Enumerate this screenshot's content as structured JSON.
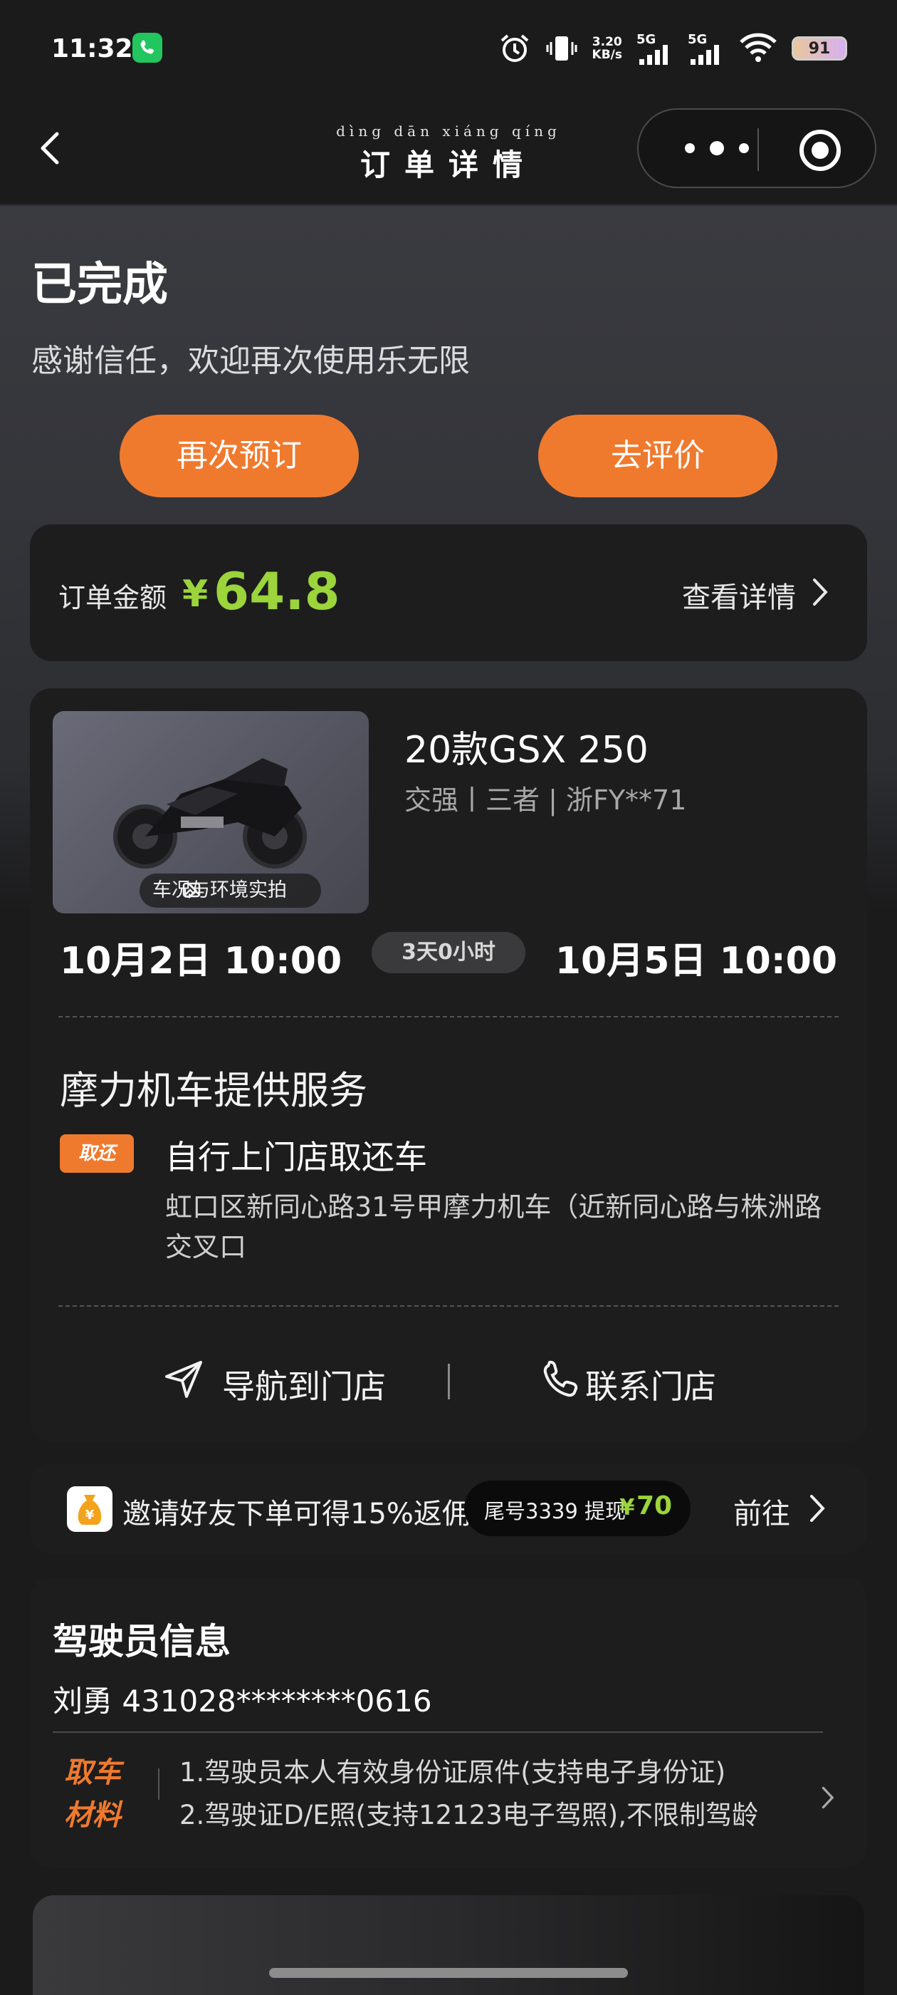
{
  "status_bar": {
    "time": "11:32",
    "net_speed_value": "3.20",
    "net_speed_unit": "KB/s",
    "signal1": "5G",
    "signal2": "5G",
    "battery": "91"
  },
  "nav": {
    "pinyin": "dìng dān xiáng qíng",
    "title": "订单详情"
  },
  "order_status": {
    "title": "已完成",
    "subtitle": "感谢信任，欢迎再次使用乐无限",
    "rebook_label": "再次预订",
    "review_label": "去评价"
  },
  "amount": {
    "label": "订单金额",
    "currency": "¥",
    "value": "64.8",
    "detail_label": "查看详情"
  },
  "vehicle": {
    "name": "20款GSX 250",
    "meta": "交强丨三者 | 浙FY**71",
    "photo_tag": "车况与环境实拍",
    "start": "10月2日 10:00",
    "duration": "3天0小时",
    "end": "10月5日 10:00",
    "provider": "摩力机车提供服务",
    "pickup_tag": "取还",
    "pickup_title": "自行上门店取还车",
    "address": "虹口区新同心路31号甲摩力机车（近新同心路与株洲路交叉口",
    "navigate_label": "导航到门店",
    "contact_label": "联系门店"
  },
  "invite": {
    "text": "邀请好友下单可得15%返佣",
    "pill_text": "尾号3339 提现",
    "pill_currency": "¥",
    "pill_value": "70",
    "go_label": "前往"
  },
  "driver": {
    "title": "驾驶员信息",
    "info": "刘勇   431028********0616",
    "material_tag_line1": "取车",
    "material_tag_line2": "材料",
    "item1": "1.驾驶员本人有效身份证原件(支持电子身份证)",
    "item2": "2.驾驶证D/E照(支持12123电子驾照),不限制驾龄"
  },
  "colors": {
    "accent": "#ef7a2e",
    "price": "#9bd43b",
    "background": "#1b1b1c",
    "card": "#1d1d1e"
  }
}
